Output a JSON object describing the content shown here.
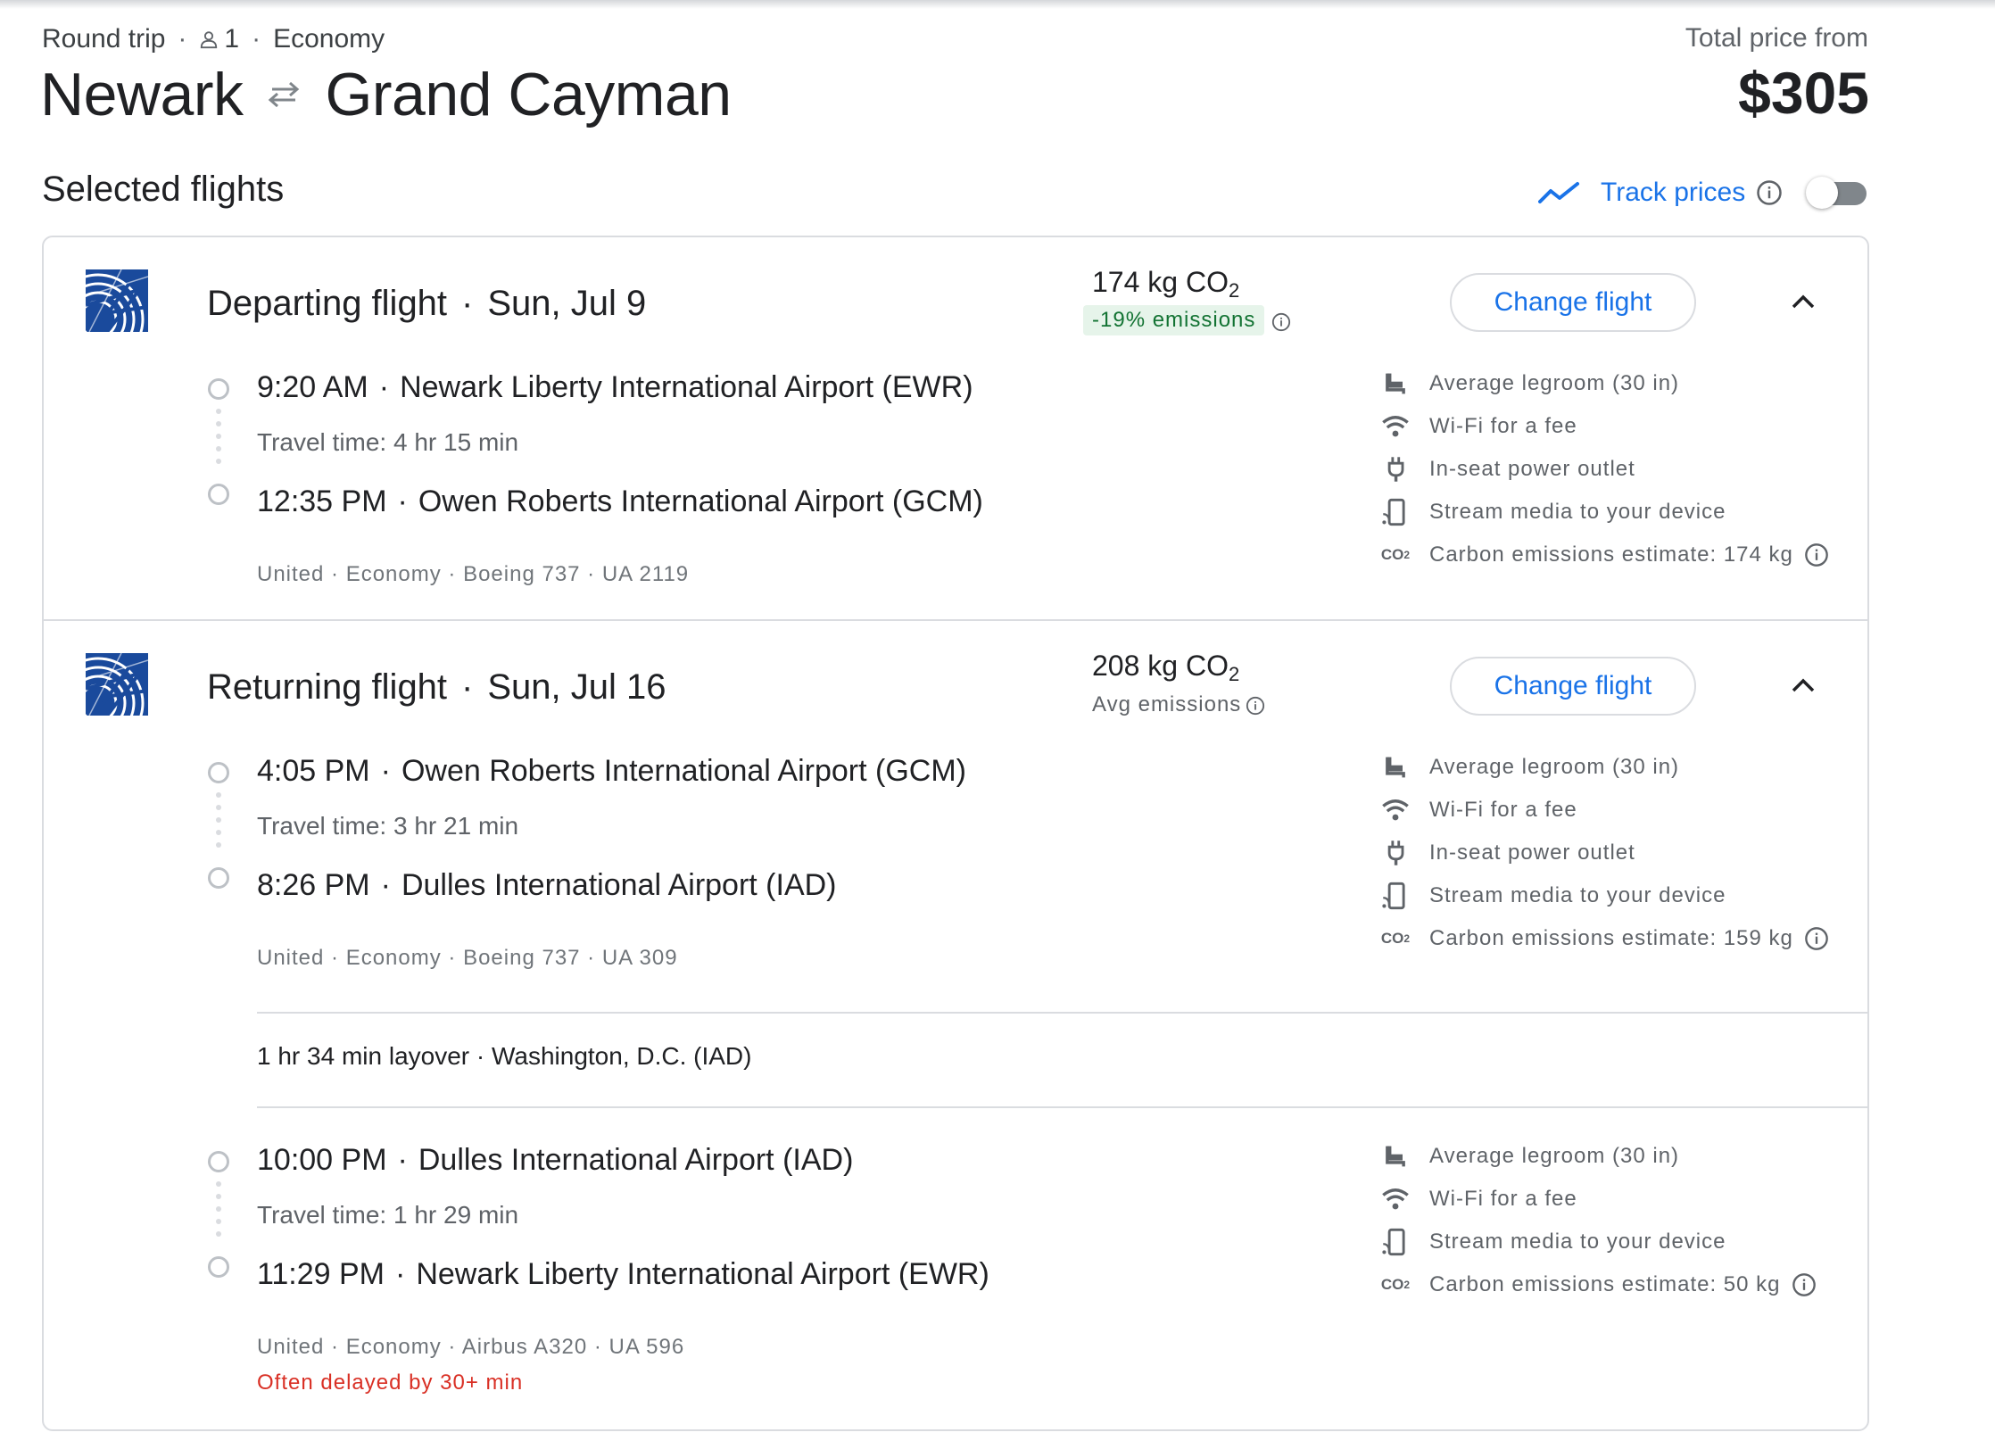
{
  "header": {
    "trip_type": "Round trip",
    "passengers": "1",
    "cabin": "Economy",
    "origin": "Newark",
    "destination": "Grand Cayman",
    "price_label": "Total price from",
    "price": "$305"
  },
  "section_title": "Selected flights",
  "track_prices_label": "Track prices",
  "track_prices_on": false,
  "colors": {
    "accent": "#1a73e8",
    "green": "#137333",
    "red": "#d93025"
  },
  "change_label": "Change flight",
  "departing": {
    "heading": "Departing flight",
    "date": "Sun, Jul 9",
    "co2": "174 kg CO",
    "emissions": "-19% emissions",
    "segment": {
      "dep_time": "9:20 AM",
      "dep_airport": "Newark Liberty International Airport (EWR)",
      "travel_time": "Travel time: 4 hr 15 min",
      "arr_time": "12:35 PM",
      "arr_airport": "Owen Roberts International Airport (GCM)",
      "details": "United · Economy · Boeing 737 · UA 2119",
      "amenities": [
        "Average legroom (30 in)",
        "Wi-Fi for a fee",
        "In-seat power outlet",
        "Stream media to your device",
        "Carbon emissions estimate: 174 kg"
      ]
    }
  },
  "returning": {
    "heading": "Returning flight",
    "date": "Sun, Jul 16",
    "co2": "208 kg CO",
    "emissions": "Avg emissions",
    "segment1": {
      "dep_time": "4:05 PM",
      "dep_airport": "Owen Roberts International Airport (GCM)",
      "travel_time": "Travel time: 3 hr 21 min",
      "arr_time": "8:26 PM",
      "arr_airport": "Dulles International Airport (IAD)",
      "details": "United · Economy · Boeing 737 · UA 309",
      "amenities": [
        "Average legroom (30 in)",
        "Wi-Fi for a fee",
        "In-seat power outlet",
        "Stream media to your device",
        "Carbon emissions estimate: 159 kg"
      ]
    },
    "layover": "1 hr 34 min layover · Washington, D.C. (IAD)",
    "segment2": {
      "dep_time": "10:00 PM",
      "dep_airport": "Dulles International Airport (IAD)",
      "travel_time": "Travel time: 1 hr 29 min",
      "arr_time": "11:29 PM",
      "arr_airport": "Newark Liberty International Airport (EWR)",
      "details": "United · Economy · Airbus A320 · UA 596",
      "delay": "Often delayed by 30+ min",
      "amenities": [
        "Average legroom (30 in)",
        "Wi-Fi for a fee",
        "Stream media to your device",
        "Carbon emissions estimate: 50 kg"
      ]
    }
  }
}
